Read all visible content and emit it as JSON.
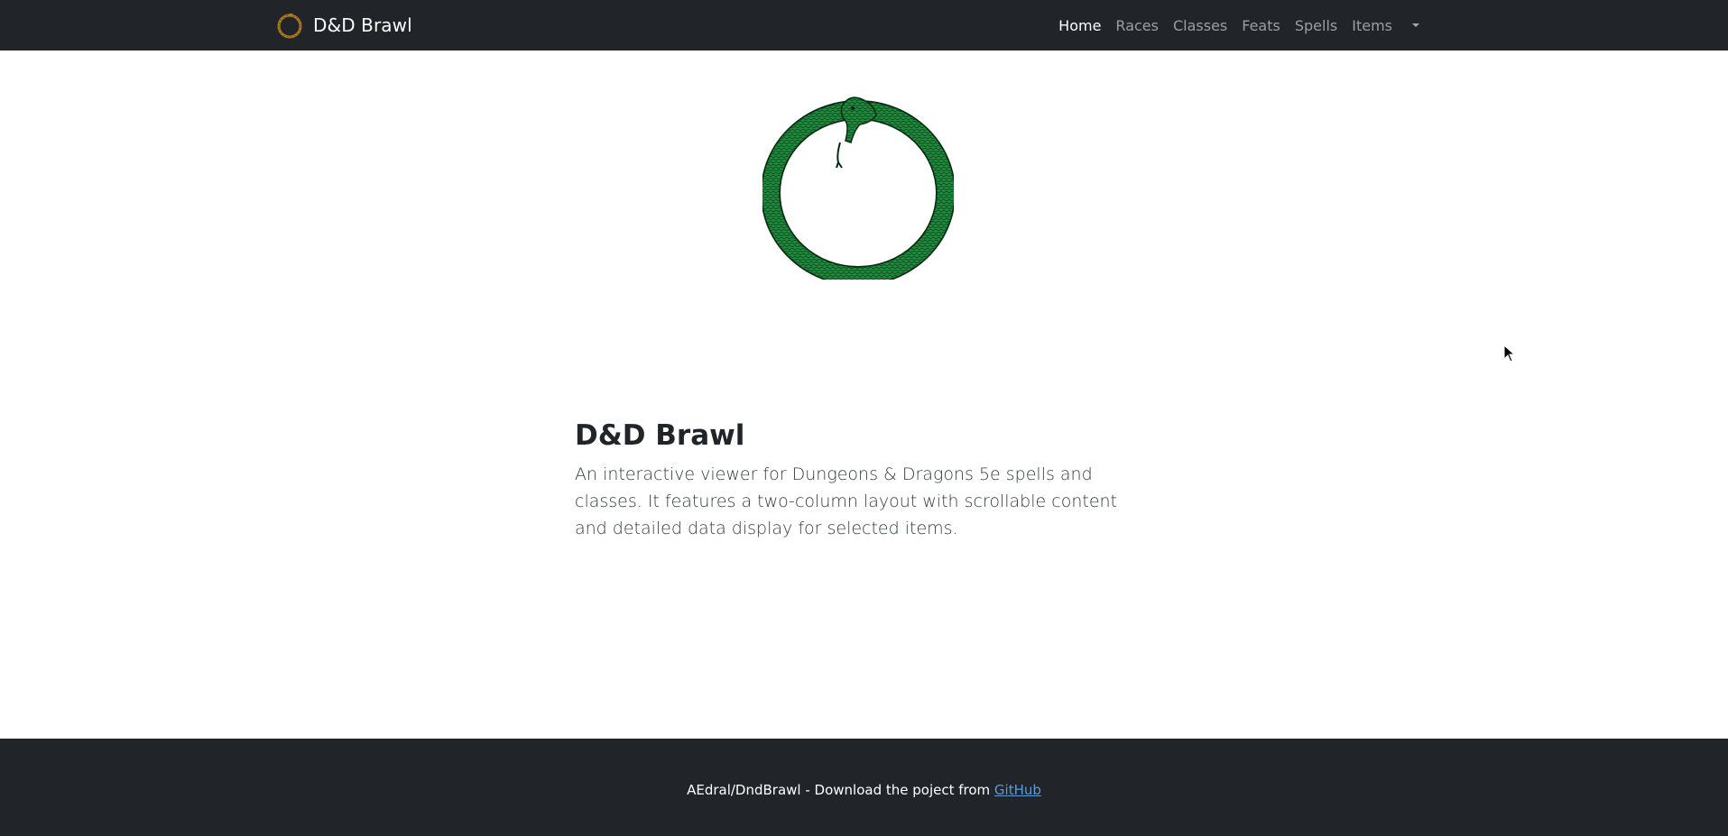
{
  "navbar": {
    "brand": "D&D Brawl",
    "links": [
      {
        "label": "Home",
        "active": true
      },
      {
        "label": "Races",
        "active": false
      },
      {
        "label": "Classes",
        "active": false
      },
      {
        "label": "Feats",
        "active": false
      },
      {
        "label": "Spells",
        "active": false
      },
      {
        "label": "Items",
        "active": false
      }
    ],
    "more_icon": "caret-down-icon",
    "brand_icon": "ouroboros-icon"
  },
  "hero": {
    "logo_icon": "ouroboros-snake-icon",
    "title": "D&D Brawl",
    "description": "An interactive viewer for Dungeons & Dragons 5e spells and classes. It features a two-column layout with scrollable content and detailed data display for selected items."
  },
  "footer": {
    "text": "AEdral/DndBrawl - Download the poject from ",
    "link_label": "GitHub"
  },
  "colors": {
    "navbar_bg": "#212529",
    "footer_bg": "#212529",
    "snake_green": "#1e8a3c",
    "brand_gold": "#b07a1e",
    "link_blue": "#5b9bd5"
  }
}
